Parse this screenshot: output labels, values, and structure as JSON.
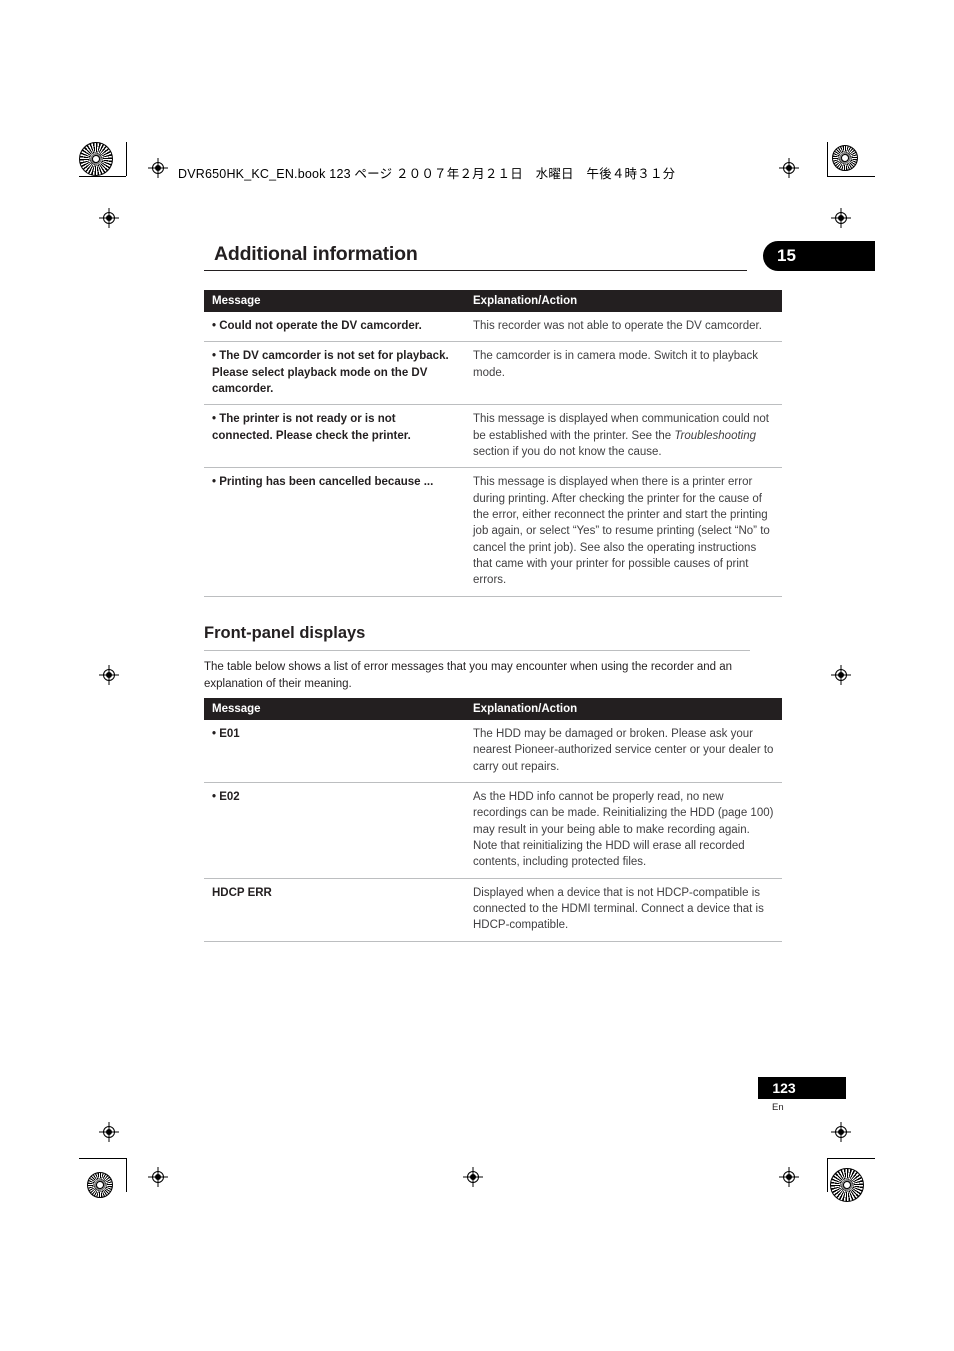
{
  "header": {
    "file_line": "DVR650HK_KC_EN.book  123 ページ  ２００７年２月２１日　水曜日　午後４時３１分"
  },
  "chapter": {
    "title": "Additional information",
    "number": "15"
  },
  "table_top": {
    "headers": [
      "Message",
      "Explanation/Action"
    ],
    "rows": [
      {
        "message": "• Could not operate the DV camcorder.",
        "explanation": "This recorder was not able to operate the DV camcorder."
      },
      {
        "message": "• The DV camcorder is not set for playback. Please select playback mode on the DV camcorder.",
        "explanation": "The camcorder is in camera mode. Switch it to playback mode."
      },
      {
        "message": "• The printer is not ready or is not connected. Please check the printer.",
        "explanation_pre": "This message is displayed when communication could not be established with the printer. See the ",
        "explanation_italic": "Troubleshooting",
        "explanation_post": " section if you do not know the cause."
      },
      {
        "message": "• Printing has been cancelled because ...",
        "explanation": "This message is displayed when there is a printer error during printing. After checking the printer for the cause of the error, either reconnect the printer and start the printing job again, or select “Yes” to resume printing (select “No” to cancel the print job). See also the operating instructions that came with your printer for possible causes of print errors."
      }
    ]
  },
  "section": {
    "heading": "Front-panel displays",
    "paragraph": "The table below shows a list of error messages that you may encounter when using the recorder and an explanation of their meaning."
  },
  "table_bottom": {
    "headers": [
      "Message",
      "Explanation/Action"
    ],
    "rows": [
      {
        "message": "• E01",
        "explanation": "The HDD may be damaged or broken. Please ask your nearest Pioneer-authorized service center or your dealer to carry out repairs."
      },
      {
        "message": "• E02",
        "explanation": "As the HDD info cannot be properly read, no new recordings can be made. Reinitializing the HDD (page 100) may result in your being able to make recording again. Note that reinitializing the HDD will erase all recorded contents, including protected files."
      },
      {
        "message": "HDCP ERR",
        "explanation": "Displayed when a device that is not HDCP-compatible is connected to the HDMI terminal. Connect a device that is HDCP-compatible."
      }
    ]
  },
  "footer": {
    "page_number": "123",
    "language": "En"
  }
}
